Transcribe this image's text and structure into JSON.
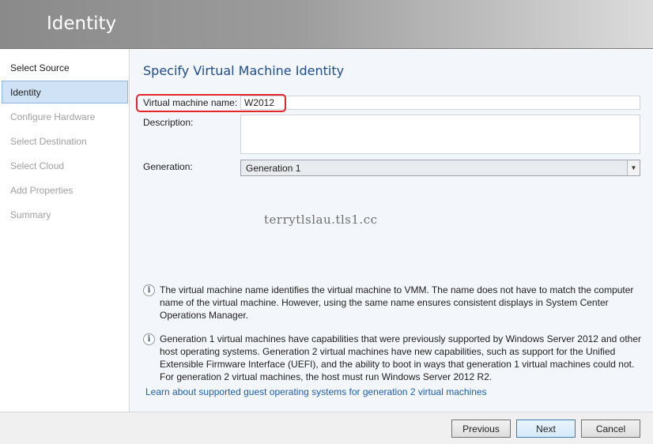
{
  "header": {
    "title": "Identity"
  },
  "sidebar": {
    "items": [
      {
        "label": "Select Source",
        "state": "done"
      },
      {
        "label": "Identity",
        "state": "active"
      },
      {
        "label": "Configure Hardware",
        "state": "pending"
      },
      {
        "label": "Select Destination",
        "state": "pending"
      },
      {
        "label": "Select Cloud",
        "state": "pending"
      },
      {
        "label": "Add Properties",
        "state": "pending"
      },
      {
        "label": "Summary",
        "state": "pending"
      }
    ]
  },
  "main": {
    "title": "Specify Virtual Machine Identity",
    "vm_name": {
      "label": "Virtual machine name:",
      "value": "W2012"
    },
    "description": {
      "label": "Description:",
      "value": ""
    },
    "generation": {
      "label": "Generation:",
      "selected": "Generation 1"
    },
    "watermark": "terrytlslau.tls1.cc",
    "info": [
      {
        "icon": "info-icon",
        "text": "The virtual machine name identifies the virtual machine to VMM. The name does not have to match the computer name of the virtual machine. However, using the same name ensures consistent displays in System Center Operations Manager."
      },
      {
        "icon": "info-icon",
        "text": "Generation 1 virtual machines have capabilities that were previously supported by Windows Server 2012 and other host operating systems. Generation 2 virtual machines have new capabilities, such as support for the Unified Extensible Firmware Interface (UEFI), and the ability to boot in ways that generation 1 virtual machines could not. For generation 2 virtual machines, the host must run Windows Server 2012 R2."
      }
    ],
    "help_link": "Learn about supported guest operating systems for generation 2 virtual machines"
  },
  "footer": {
    "previous_label": "Previous",
    "next_label": "Next",
    "cancel_label": "Cancel"
  },
  "colors": {
    "accent_title": "#1f4c8a",
    "link": "#1f5fae",
    "highlight": "#e2262b",
    "active_nav_bg": "#cfe2f6"
  }
}
